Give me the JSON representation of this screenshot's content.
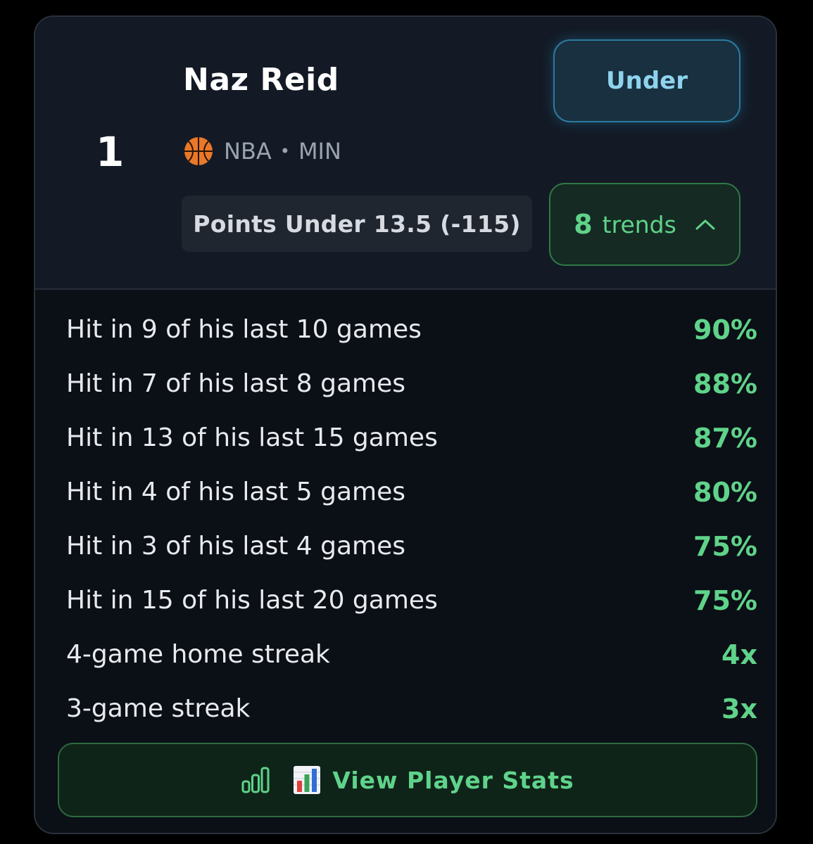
{
  "card": {
    "rank": "1",
    "player_name": "Naz Reid",
    "league": "NBA",
    "separator": "•",
    "team": "MIN",
    "prop": "Points Under 13.5 (-115)",
    "pick_label": "Under",
    "trends_count": "8",
    "trends_label": "trends",
    "trends": [
      {
        "label": "Hit in 9 of his last 10 games",
        "value": "90%"
      },
      {
        "label": "Hit in 7 of his last 8 games",
        "value": "88%"
      },
      {
        "label": "Hit in 13 of his last 15 games",
        "value": "87%"
      },
      {
        "label": "Hit in 4 of his last 5 games",
        "value": "80%"
      },
      {
        "label": "Hit in 3 of his last 4 games",
        "value": "75%"
      },
      {
        "label": "Hit in 15 of his last 20 games",
        "value": "75%"
      },
      {
        "label": "4-game home streak",
        "value": "4x"
      },
      {
        "label": "3-game streak",
        "value": "3x"
      }
    ],
    "stats_button_label": "View Player Stats"
  },
  "icons": {
    "sport": "basketball-icon",
    "trends_toggle": "chevron-up-icon",
    "stats_outline": "bar-chart-icon",
    "stats_emoji": "bar-chart-emoji-icon"
  },
  "colors": {
    "background": "#000000",
    "card": "#0b0f16",
    "header": "#131a25",
    "accent_green": "#5fd38a",
    "accent_blue": "#8fd3ee"
  }
}
